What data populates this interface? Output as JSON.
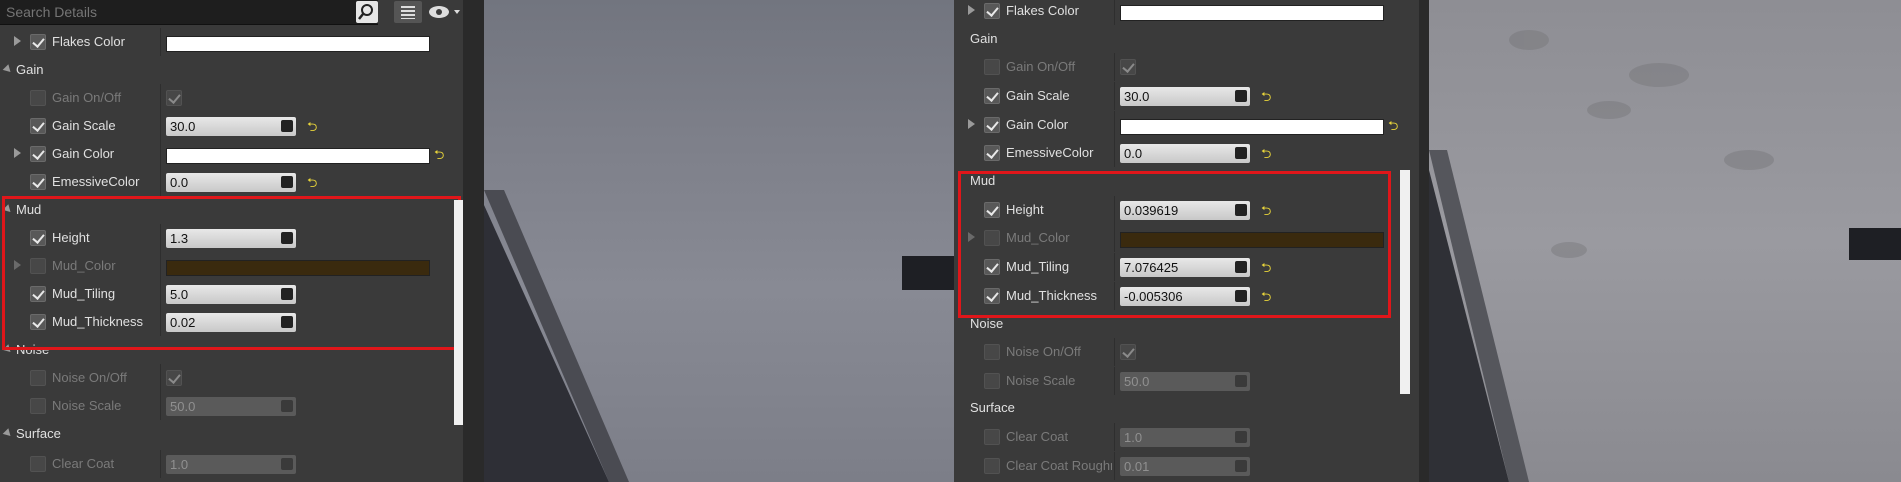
{
  "search": {
    "placeholder": "Search Details"
  },
  "left": {
    "flakes_color": "Flakes Color",
    "gain_header": "Gain",
    "gain_onoff": "Gain On/Off",
    "gain_scale": {
      "label": "Gain Scale",
      "value": "30.0"
    },
    "gain_color": "Gain Color",
    "emessive": {
      "label": "EmessiveColor",
      "value": "0.0"
    },
    "mud_header": "Mud",
    "height": {
      "label": "Height",
      "value": "1.3"
    },
    "mud_color": "Mud_Color",
    "mud_tiling": {
      "label": "Mud_Tiling",
      "value": "5.0"
    },
    "mud_thickness": {
      "label": "Mud_Thickness",
      "value": "0.02"
    },
    "noise_header": "Noise",
    "noise_onoff": "Noise On/Off",
    "noise_scale": {
      "label": "Noise Scale",
      "value": "50.0"
    },
    "surface_header": "Surface",
    "clear_coat": {
      "label": "Clear Coat",
      "value": "1.0"
    }
  },
  "right": {
    "flakes_color": "Flakes Color",
    "gain_header": "Gain",
    "gain_onoff": "Gain On/Off",
    "gain_scale": {
      "label": "Gain Scale",
      "value": "30.0"
    },
    "gain_color": "Gain Color",
    "emessive": {
      "label": "EmessiveColor",
      "value": "0.0"
    },
    "mud_header": "Mud",
    "height": {
      "label": "Height",
      "value": "0.039619"
    },
    "mud_color": "Mud_Color",
    "mud_tiling": {
      "label": "Mud_Tiling",
      "value": "7.076425"
    },
    "mud_thickness": {
      "label": "Mud_Thickness",
      "value": "-0.005306"
    },
    "noise_header": "Noise",
    "noise_onoff": "Noise On/Off",
    "noise_scale": {
      "label": "Noise Scale",
      "value": "50.0"
    },
    "surface_header": "Surface",
    "clear_coat": {
      "label": "Clear Coat",
      "value": "1.0"
    },
    "clear_coat_roughness": {
      "label": "Clear Coat Roughne",
      "value": "0.01"
    }
  },
  "colors": {
    "highlight": "#e0161a",
    "reset_arrow": "#e8d43a",
    "mud_color": "#3a2a0e"
  },
  "icons": {
    "reset": "reset-arrow-icon",
    "search": "search-icon",
    "eye": "eye-icon",
    "grid": "grid-icon"
  }
}
